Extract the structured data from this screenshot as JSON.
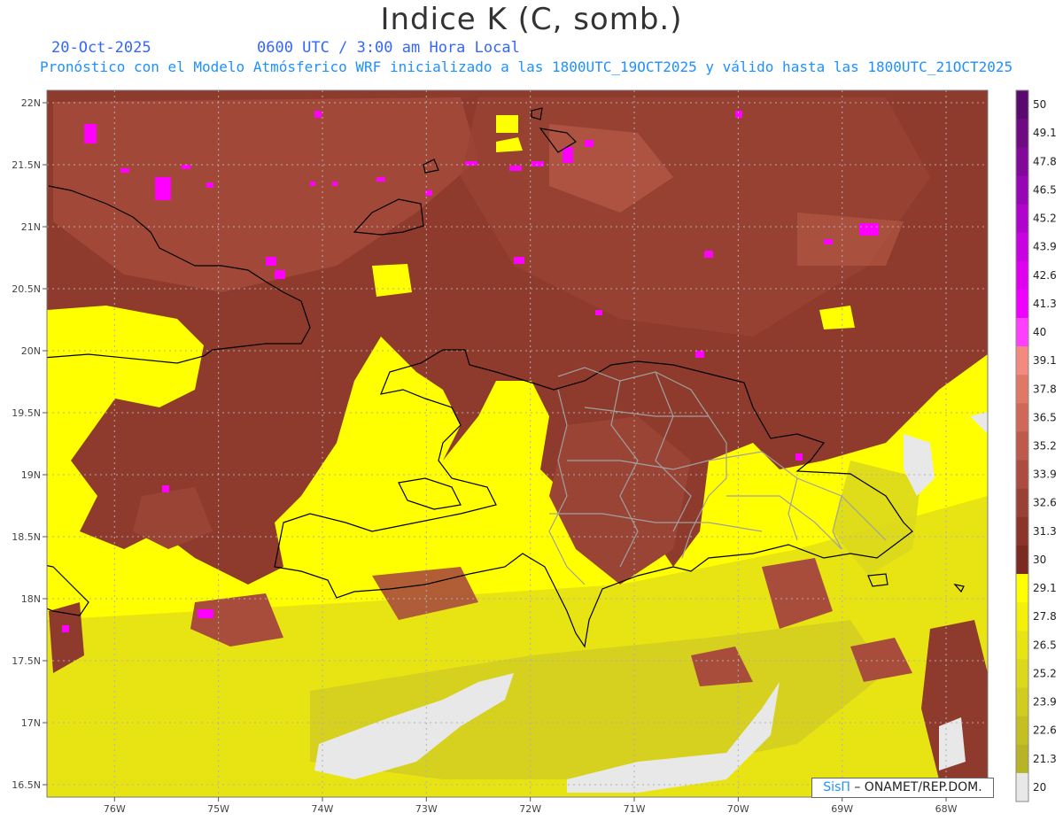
{
  "header": {
    "title": "Indice K (C, somb.)",
    "date": "20-Oct-2025",
    "time": "0600 UTC / 3:00 am Hora Local",
    "description": "Pronóstico con el Modelo Atmósferico WRF inicializado a las 1800UTC_19OCT2025 y válido hasta las  1800UTC_21OCT2025"
  },
  "map": {
    "lat_range": [
      16.4,
      22.1
    ],
    "lon_range": [
      -76.65,
      -67.6
    ],
    "lat_ticks": [
      "22N",
      "21.5N",
      "21N",
      "20.5N",
      "20N",
      "19.5N",
      "19N",
      "18.5N",
      "18N",
      "17.5N",
      "17N",
      "16.5N"
    ],
    "lat_values": [
      22,
      21.5,
      21,
      20.5,
      20,
      19.5,
      19,
      18.5,
      18,
      17.5,
      17,
      16.5
    ],
    "lon_ticks": [
      "76W",
      "75W",
      "74W",
      "73W",
      "72W",
      "71W",
      "70W",
      "69W",
      "68W"
    ],
    "lon_values": [
      -76,
      -75,
      -74,
      -73,
      -72,
      -71,
      -70,
      -69,
      -68
    ],
    "grid": true
  },
  "colorbar": {
    "labels": [
      "50",
      "49.1",
      "47.8",
      "46.5",
      "45.2",
      "43.9",
      "42.6",
      "41.3",
      "40",
      "39.1",
      "37.8",
      "36.5",
      "35.2",
      "33.9",
      "32.6",
      "31.3",
      "30",
      "29.1",
      "27.8",
      "26.5",
      "25.2",
      "23.9",
      "22.6",
      "21.3",
      "20"
    ],
    "colors": [
      "#5a0a6e",
      "#6e0a82",
      "#82089a",
      "#9606b4",
      "#b004cc",
      "#c802e0",
      "#e000f0",
      "#f000ff",
      "#ff40ff",
      "#f28a80",
      "#e07868",
      "#cf6858",
      "#bd5a4c",
      "#ac4c40",
      "#9a4034",
      "#8a342a",
      "#7a2a20",
      "#ffff00",
      "#f4f00a",
      "#e8e414",
      "#dcd81c",
      "#d0cc20",
      "#c4c024",
      "#b8b428",
      "#e8e8e8"
    ]
  },
  "footer": {
    "brand": "SisΠ",
    "credit": " – ONAMET/REP.DOM."
  }
}
